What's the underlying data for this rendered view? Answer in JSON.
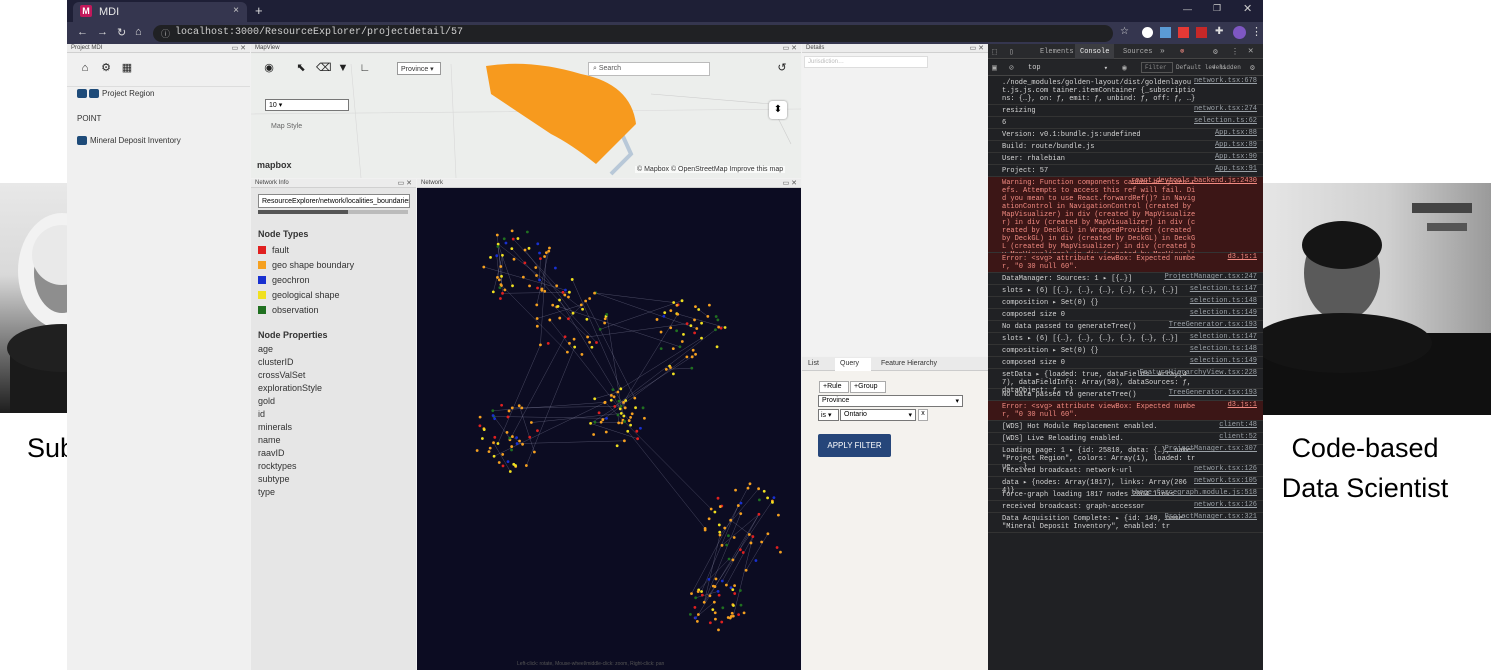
{
  "captions": {
    "left": "Subject Matter Expert",
    "right": "Code-based Data Scientist"
  },
  "browser": {
    "tab_title": "MDI",
    "new_tab": "+",
    "url": "localhost:3000/ResourceExplorer/projectdetail/57"
  },
  "project_panel": {
    "title": "Project MDI",
    "items": [
      "Project Region",
      "POINT",
      "Mineral Deposit Inventory"
    ]
  },
  "map_view": {
    "title": "MapView",
    "dropdown": "Province",
    "search_placeholder": "Search",
    "select_value": "10",
    "map_style_label": "Map Style",
    "attribution": "© Mapbox © OpenStreetMap  Improve this map",
    "logo": "mapbox"
  },
  "details": {
    "title": "Details",
    "value": "Jurisdiction…"
  },
  "network_info": {
    "title": "Network Info",
    "path_field": "ResourceExplorer/network/localities_boundaries",
    "node_types_heading": "Node Types",
    "node_types": [
      {
        "label": "fault",
        "color": "#e02020"
      },
      {
        "label": "geo shape boundary",
        "color": "#f5a020"
      },
      {
        "label": "geochron",
        "color": "#1830d0"
      },
      {
        "label": "geological shape",
        "color": "#f0e020"
      },
      {
        "label": "observation",
        "color": "#207020"
      }
    ],
    "node_properties_heading": "Node Properties",
    "node_properties": [
      "age",
      "clusterID",
      "crossValSet",
      "explorationStyle",
      "gold",
      "id",
      "minerals",
      "name",
      "raavID",
      "rocktypes",
      "subtype",
      "type"
    ]
  },
  "network": {
    "title": "Network",
    "footer_hint": "Left-click: rotate, Mouse-wheel/middle-click: zoom, Right-click: pan"
  },
  "query_panel": {
    "tabs": [
      "List",
      "Query",
      "Feature Hierarchy"
    ],
    "rule_button": "+Rule",
    "group_button": "+Group",
    "field_value": "Province",
    "operator_value": "is",
    "operand_value": "Ontario",
    "remove": "x",
    "apply_button": "APPLY FILTER"
  },
  "devtools": {
    "tabs": [
      "Elements",
      "Console",
      "Sources"
    ],
    "filter_value": "top",
    "filter_placeholder": "Filter",
    "level": "Default levels",
    "hidden": "4 hidden",
    "lines": [
      {
        "text": "./node_modules/golden-layout/dist/goldenlayout.js.js.com tainer.itemContainer {_subscriptions: {…}, on: ƒ, emit: ƒ, unbind: ƒ, off: ƒ, …}",
        "src": "network.tsx:678",
        "type": "log"
      },
      {
        "text": "resizing",
        "src": "network.tsx:274",
        "type": "log"
      },
      {
        "text": "6",
        "src": "selection.ts:62",
        "type": "log"
      },
      {
        "text": "Version: v0.1:bundle.js:undefined",
        "src": "App.tsx:88",
        "type": "log"
      },
      {
        "text": "Build: route/bundle.js",
        "src": "App.tsx:89",
        "type": "log"
      },
      {
        "text": "User: rhalebian",
        "src": "App.tsx:90",
        "type": "log"
      },
      {
        "text": "Project: 57",
        "src": "App.tsx:91",
        "type": "log"
      },
      {
        "text": "Warning: Function components cannot be given refs. Attempts to access this ref will fail. Did you mean to use React.forwardRef()? in NavigationControl in NavigationControl (created by MapVisualizer) in div (created by MapVisualizer) in div (created by MapVisualizer) in div (created by DeckGL) in WrappedProvider (created by DeckGL) in div (created by DeckGL) in DeckGL (created by MapVisualizer) in div (created by MapVisualizer) in div (created by MapVisualizer) in MapVisualizer",
        "src": "react_devtools_backend.js:2430",
        "type": "err"
      },
      {
        "text": "Error: <svg> attribute viewBox: Expected number, \"0 30 null 60\".",
        "src": "d3.js:1",
        "type": "err"
      },
      {
        "text": "DataManager: Sources: 1 ▸ [{…}]",
        "src": "ProjectManager.tsx:247",
        "type": "log"
      },
      {
        "text": "slots ▸ (6) [{…}, {…}, {…}, {…}, {…}, {…}]",
        "src": "selection.ts:147",
        "type": "log"
      },
      {
        "text": "composition ▸ Set(0) {}",
        "src": "selection.ts:148",
        "type": "log"
      },
      {
        "text": "composed size 0",
        "src": "selection.ts:149",
        "type": "log"
      },
      {
        "text": "No data passed to generateTree()",
        "src": "TreeGenerator.tsx:193",
        "type": "log"
      },
      {
        "text": "slots ▸ (6) [{…}, {…}, {…}, {…}, {…}, {…}]",
        "src": "selection.ts:147",
        "type": "log"
      },
      {
        "text": "composition ▸ Set(0) {}",
        "src": "selection.ts:148",
        "type": "log"
      },
      {
        "text": "composed size 0",
        "src": "selection.ts:149",
        "type": "log"
      },
      {
        "text": "setData ▸ {loaded: true, dataFields: Array(47), dataFieldInfo: Array(50), dataSources: ƒ, dataObject: ƒ, …}",
        "src": "FeatureHierarchyView.tsx:228",
        "type": "log"
      },
      {
        "text": "No data passed to generateTree()",
        "src": "TreeGenerator.tsx:193",
        "type": "log"
      },
      {
        "text": "Error: <svg> attribute viewBox: Expected number, \"0 30 null 60\".",
        "src": "d3.js:1",
        "type": "err"
      },
      {
        "text": "[WDS] Hot Module Replacement enabled.",
        "src": "client:48",
        "type": "log"
      },
      {
        "text": "[WDS] Live Reloading enabled.",
        "src": "client:52",
        "type": "log"
      },
      {
        "text": "Loading page: 1 ▸ {id: 25810, data: {…}, name: \"Project Region\", colors: Array(1), loaded: true, …}",
        "src": "ProjectManager.tsx:307",
        "type": "log"
      },
      {
        "text": "received broadcast: network-url",
        "src": "network.tsx:126",
        "type": "log"
      },
      {
        "text": "data ▸ {nodes: Array(1817), links: Array(2064)}",
        "src": "network.tsx:105",
        "type": "log"
      },
      {
        "text": "force-graph loading 1817 nodes 2064 links",
        "src": "three-forcegraph.module.js:518",
        "type": "log"
      },
      {
        "text": "received broadcast: graph-accessor",
        "src": "network.tsx:126",
        "type": "log"
      },
      {
        "text": "Data Acquisition Complete: ▸ {id: 140, name: \"Mineral Deposit Inventory\", enabled: tr",
        "src": "ProjectManager.tsx:321",
        "type": "log"
      }
    ]
  }
}
